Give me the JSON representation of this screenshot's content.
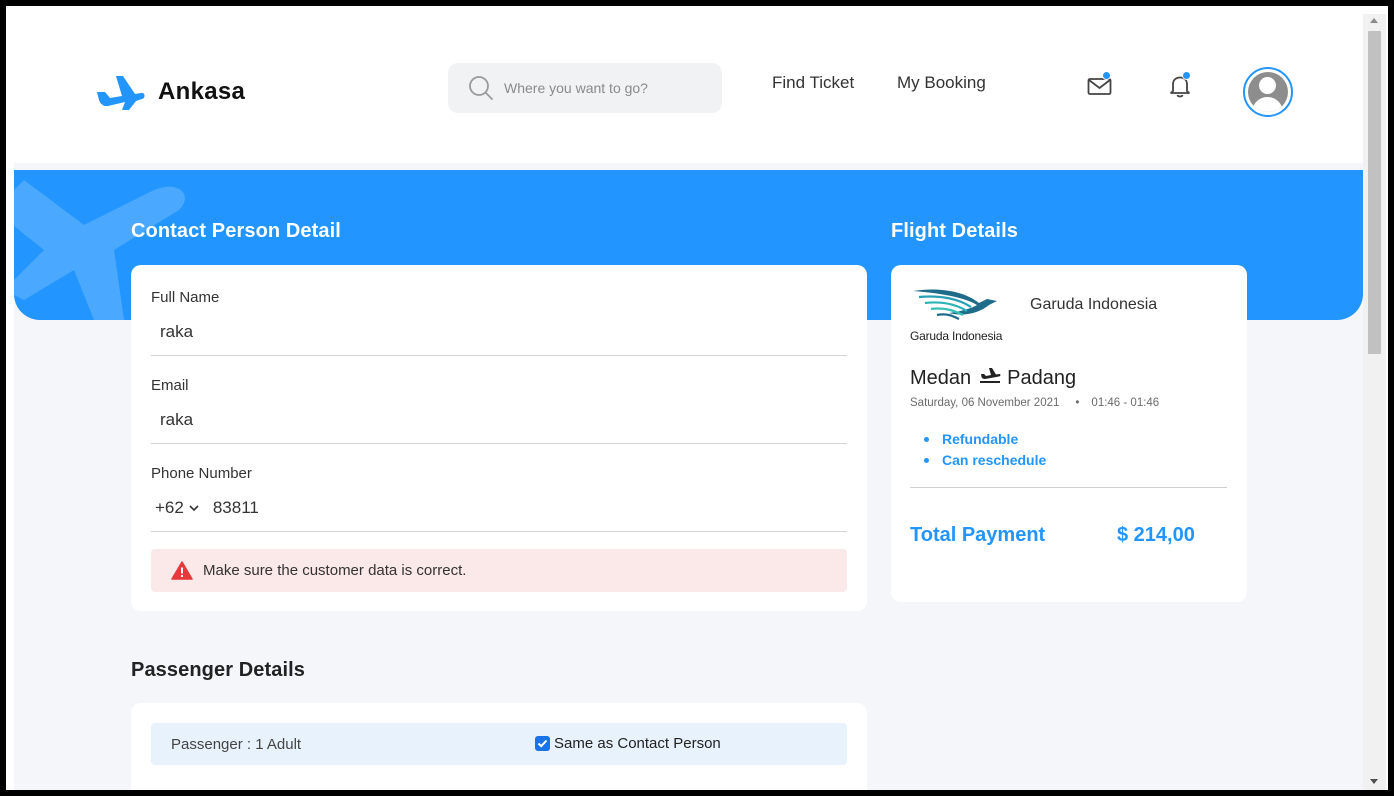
{
  "app": {
    "brand": "Ankasa"
  },
  "header": {
    "search_placeholder": "Where you want to go?",
    "nav": [
      {
        "label": "Find Ticket"
      },
      {
        "label": "My Booking"
      }
    ],
    "icons": [
      "mail-icon",
      "bell-icon",
      "avatar"
    ],
    "notification_dot_color": "#2395ff"
  },
  "contact": {
    "title": "Contact Person Detail",
    "full_name_label": "Full Name",
    "full_name_value": "raka",
    "email_label": "Email",
    "email_value": "raka",
    "phone_label": "Phone Number",
    "phone_code": "+62",
    "phone_value": "83811",
    "alert_text": "Make sure the customer data is correct."
  },
  "flight": {
    "title": "Flight Details",
    "airline_logo_text": "Garuda Indonesia",
    "airline_name": "Garuda Indonesia",
    "from": "Medan",
    "to": "Padang",
    "date": "Saturday, 06 November 2021",
    "time": "01:46 - 01:46",
    "features": [
      "Refundable",
      "Can reschedule"
    ],
    "total_label": "Total Payment",
    "total_value": "$ 214,00"
  },
  "passenger": {
    "title": "Passenger Details",
    "row_label": "Passenger : 1 Adult",
    "same_as_contact_label": "Same as Contact Person",
    "same_as_contact_checked": true
  },
  "colors": {
    "accent": "#2395ff",
    "alert_bg": "#fbe8e8",
    "alert_icon": "#e63939",
    "passenger_row_bg": "#e8f2fc",
    "page_bg": "#f5f6fa"
  }
}
